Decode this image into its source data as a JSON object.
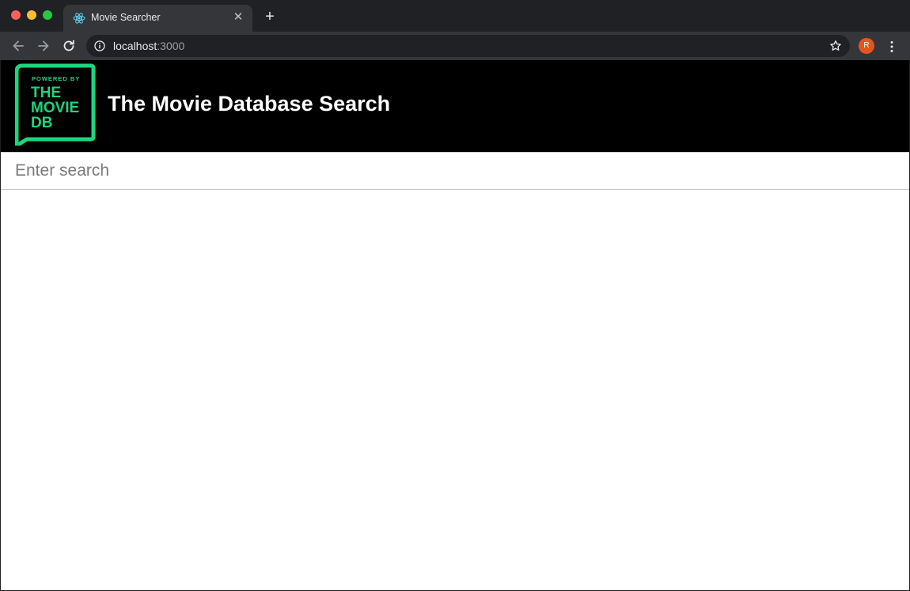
{
  "browser": {
    "tab": {
      "title": "Movie Searcher",
      "favicon": "react-icon",
      "close_glyph": "✕"
    },
    "new_tab_glyph": "+",
    "address": {
      "host": "localhost",
      "port": ":3000"
    },
    "profile_initial": "R",
    "colors": {
      "frame": "#202124",
      "toolbar": "#35363a",
      "avatar": "#e8531f"
    }
  },
  "header": {
    "logo": {
      "line1": "POWERED BY",
      "line2": "THE",
      "line3": "MOVIE",
      "line4": "DB",
      "color": "#1ed47d"
    },
    "title": "The Movie Database Search"
  },
  "search": {
    "placeholder": "Enter search",
    "value": ""
  }
}
